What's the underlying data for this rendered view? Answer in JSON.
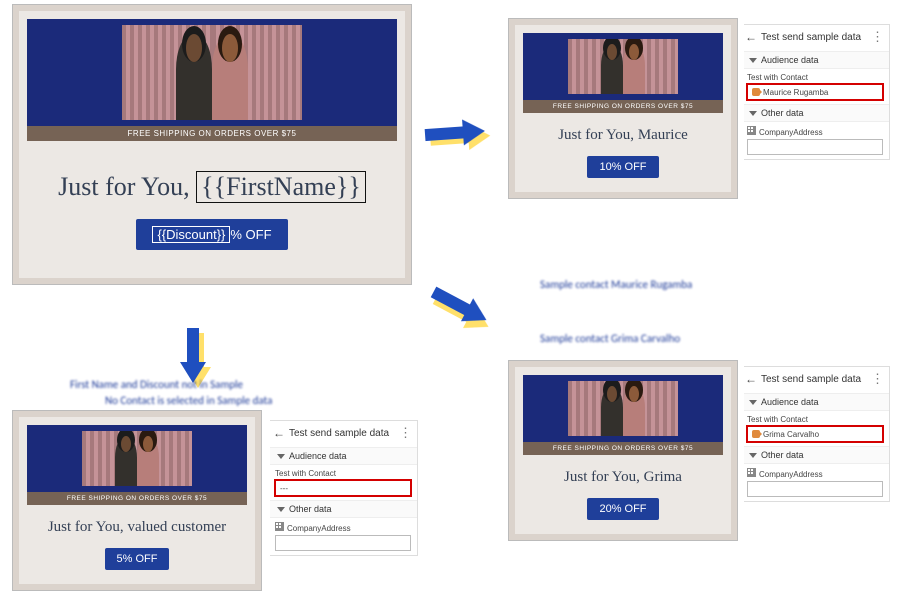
{
  "template": {
    "shipbar": "FREE SHIPPING ON ORDERS OVER $75",
    "headline_prefix": "Just for You, ",
    "firstname_token": "{{FirstName}}",
    "discount_token": "{{Discount}}",
    "discount_suffix": "% OFF"
  },
  "previews": {
    "default": {
      "name": "valued customer",
      "discount": "5% OFF"
    },
    "maurice": {
      "name": "Maurice",
      "discount": "10% OFF"
    },
    "grima": {
      "name": "Grima",
      "discount": "20% OFF"
    }
  },
  "sidepanel": {
    "title": "Test send sample data",
    "audience_section": "Audience data",
    "test_with_contact": "Test with Contact",
    "other_section": "Other data",
    "company_field": "CompanyAddress",
    "contacts": {
      "none": "---",
      "maurice": "Maurice Rugamba",
      "grima": "Grima Carvalho"
    }
  },
  "annotations": {
    "default1": "First Name and Discount not in Sample",
    "default2": "No Contact is selected in Sample data",
    "maurice": "Sample contact Maurice Rugamba",
    "grima": "Sample contact Grima Carvalho"
  }
}
